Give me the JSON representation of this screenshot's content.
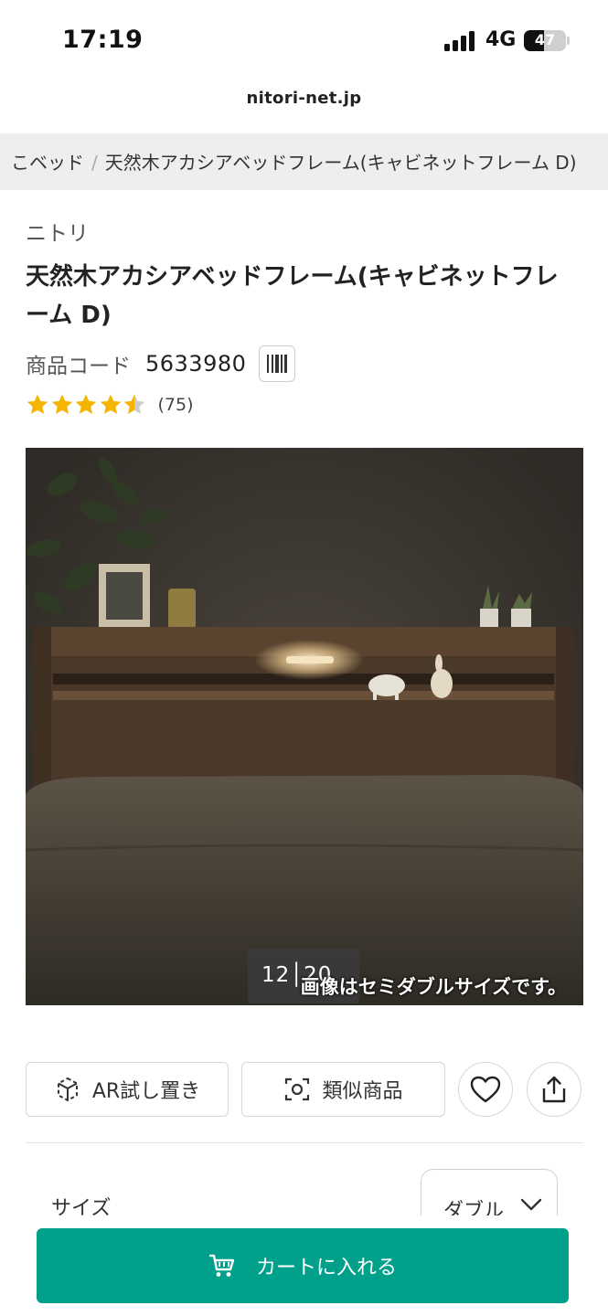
{
  "status_bar": {
    "time": "17:19",
    "network": "4G",
    "battery": "47",
    "battery_level": 0.47
  },
  "browser": {
    "url": "nitori-net.jp"
  },
  "breadcrumb": {
    "items": [
      "こベッド",
      "天然木アカシアベッドフレーム(キャビネットフレーム D)"
    ],
    "separator": "/"
  },
  "product": {
    "brand": "ニトリ",
    "title": "天然木アカシアベッドフレーム(キャビネットフレーム D)",
    "code_label": "商品コード",
    "code_value": "5633980",
    "rating": 4.5,
    "review_count": "(75)"
  },
  "media": {
    "video_time": "12│20",
    "caption": "画像はセミダブルサイズです。"
  },
  "actions": {
    "ar_label": "AR試し置き",
    "similar_label": "類似商品",
    "favorite_icon": "heart-icon",
    "share_icon": "share-icon"
  },
  "options": {
    "size_label": "サイズ",
    "size_value": "ダブル"
  },
  "cart": {
    "button_label": "カートに入れる"
  },
  "colors": {
    "accent": "#00a08a",
    "star": "#f5b400",
    "star_empty": "#cccccc"
  }
}
